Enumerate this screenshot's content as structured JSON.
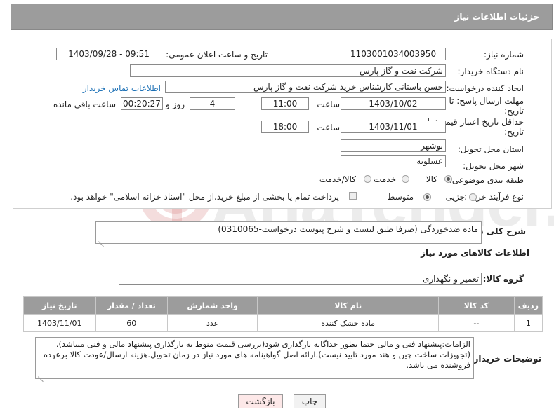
{
  "header": {
    "title": "جزئیات اطلاعات نیاز"
  },
  "form": {
    "need_number_label": "شماره نیاز:",
    "need_number": "1103001034003950",
    "announce_label": "تاریخ و ساعت اعلان عمومی:",
    "announce_value": "1403/09/28 - 09:51",
    "buyer_org_label": "نام دستگاه خریدار:",
    "buyer_org": "شرکت نفت و گاز پارس",
    "creator_label": "ایجاد کننده درخواست:",
    "creator": "حسن باستانی کارشناس خرید شرکت نفت و گاز پارس",
    "contact_link": "اطلاعات تماس خریدار",
    "deadline_label": "مهلت ارسال پاسخ: تا",
    "deadline_label2": "تاریخ:",
    "deadline_date": "1403/10/02",
    "time_label": "ساعت",
    "deadline_time": "11:00",
    "days_value": "4",
    "days_label": "روز و",
    "remaining_time": "00:20:27",
    "remaining_label": "ساعت باقی مانده",
    "validity_label": "حداقل تاریخ اعتبار قیمت: تا",
    "validity_label2": "تاریخ:",
    "validity_date": "1403/11/01",
    "validity_time": "18:00",
    "province_label": "استان محل تحویل:",
    "province": "بوشهر",
    "city_label": "شهر محل تحویل:",
    "city": "عسلویه",
    "category_label": "طبقه بندی موضوعی:",
    "category_options": [
      "کالا",
      "خدمت",
      "کالا/خدمت"
    ],
    "process_label": "نوع فرآیند خرید :",
    "process_options": [
      "جزیی",
      "متوسط"
    ],
    "payment_note": "پرداخت تمام یا بخشی از مبلغ خرید،از محل \"اسناد خزانه اسلامی\" خواهد بود."
  },
  "description": {
    "label": "شرح کلی نیاز:",
    "value": "ماده ضدخوردگی  (صرفا طبق لیست و شرح پیوست درخواست-0310065)"
  },
  "goods_section_title": "اطلاعات کالاهای مورد نیاز",
  "goods_group": {
    "label": "گروه کالا:",
    "value": "تعمیر و نگهداری"
  },
  "table": {
    "headers": [
      "ردیف",
      "کد کالا",
      "نام کالا",
      "واحد شمارش",
      "تعداد / مقدار",
      "تاریخ نیاز"
    ],
    "rows": [
      [
        "1",
        "--",
        "ماده خشک کننده",
        "عدد",
        "60",
        "1403/11/01"
      ]
    ]
  },
  "buyer_notes": {
    "label": "توضیحات خریدار:",
    "value": "الزامات:پیشنهاد فنی و مالی حتما  بطور جداگانه بارگذاری شود(بررسی قیمت منوط به بارگذاری پیشنهاد مالی و فنی میباشد).(تجهیزات ساخت چین و هند مورد تایید نیست).ارائه اصل گواهینامه های مورد نیاز در زمان تحویل.هزینه ارسال/عودت کالا برعهده فروشنده می باشد."
  },
  "buttons": {
    "print": "چاپ",
    "back": "بازگشت"
  },
  "watermark": {
    "text": "AriaTender.neT"
  },
  "colors": {
    "header_bg": "#9c9c9c",
    "link": "#1a6fb5",
    "back_btn_bg": "#fde8e8"
  }
}
